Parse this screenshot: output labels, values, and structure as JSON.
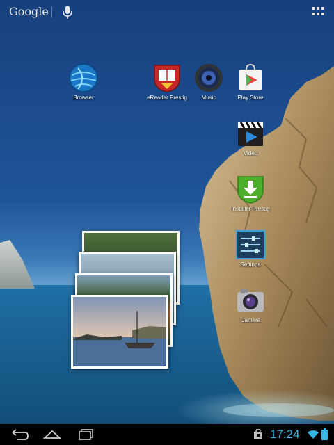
{
  "topbar": {
    "search_brand": "Google"
  },
  "apps": {
    "browser": "Browser",
    "ereader": "eReader Prestig",
    "music": "Music",
    "playstore": "Play Store",
    "video": "Video",
    "installer": "Installer Prestig",
    "settings": "Settings",
    "camera": "Camera"
  },
  "statusbar": {
    "time": "17:24"
  },
  "colors": {
    "accent": "#33b5e5",
    "navbar": "#000000"
  }
}
